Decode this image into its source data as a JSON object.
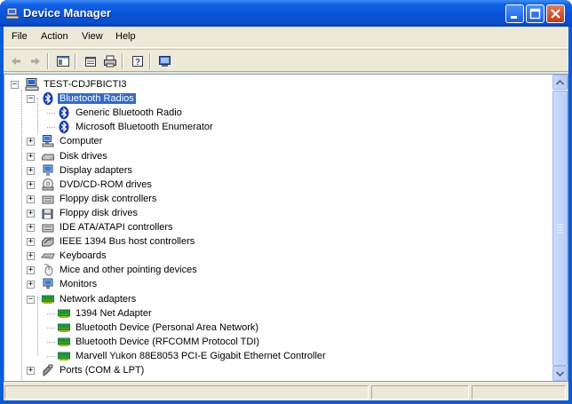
{
  "window": {
    "title": "Device Manager"
  },
  "menu": [
    "File",
    "Action",
    "View",
    "Help"
  ],
  "toolbar": {
    "back": "back-arrow-icon",
    "forward": "forward-arrow-icon",
    "tools": [
      "show-hide-console-tree-icon",
      "properties-icon",
      "print-icon",
      "help-icon",
      "scan-hardware-icon"
    ]
  },
  "tree": {
    "root": "TEST-CDJFBICTI3",
    "nodes": [
      {
        "label": "Bluetooth Radios",
        "icon": "bluetooth-icon",
        "expanded": true,
        "selected": true,
        "children": [
          "Generic Bluetooth Radio",
          "Microsoft Bluetooth Enumerator"
        ]
      },
      {
        "label": "Computer",
        "icon": "computer-icon"
      },
      {
        "label": "Disk drives",
        "icon": "disk-drive-icon"
      },
      {
        "label": "Display adapters",
        "icon": "display-adapter-icon"
      },
      {
        "label": "DVD/CD-ROM drives",
        "icon": "cdrom-icon"
      },
      {
        "label": "Floppy disk controllers",
        "icon": "controller-icon"
      },
      {
        "label": "Floppy disk drives",
        "icon": "floppy-icon"
      },
      {
        "label": "IDE ATA/ATAPI controllers",
        "icon": "controller-icon"
      },
      {
        "label": "IEEE 1394 Bus host controllers",
        "icon": "ieee1394-icon"
      },
      {
        "label": "Keyboards",
        "icon": "keyboard-icon"
      },
      {
        "label": "Mice and other pointing devices",
        "icon": "mouse-icon"
      },
      {
        "label": "Monitors",
        "icon": "monitor-icon"
      },
      {
        "label": "Network adapters",
        "icon": "network-adapter-icon",
        "expanded": true,
        "children": [
          "1394 Net Adapter",
          "Bluetooth Device (Personal Area Network)",
          "Bluetooth Device (RFCOMM Protocol TDI)",
          "Marvell Yukon 88E8053 PCI-E Gigabit Ethernet Controller"
        ]
      },
      {
        "label": "Ports (COM & LPT)",
        "icon": "port-icon"
      }
    ]
  },
  "colors": {
    "titlebar": "#0a53d6",
    "selection": "#316ac5",
    "chrome": "#ece9d8"
  }
}
